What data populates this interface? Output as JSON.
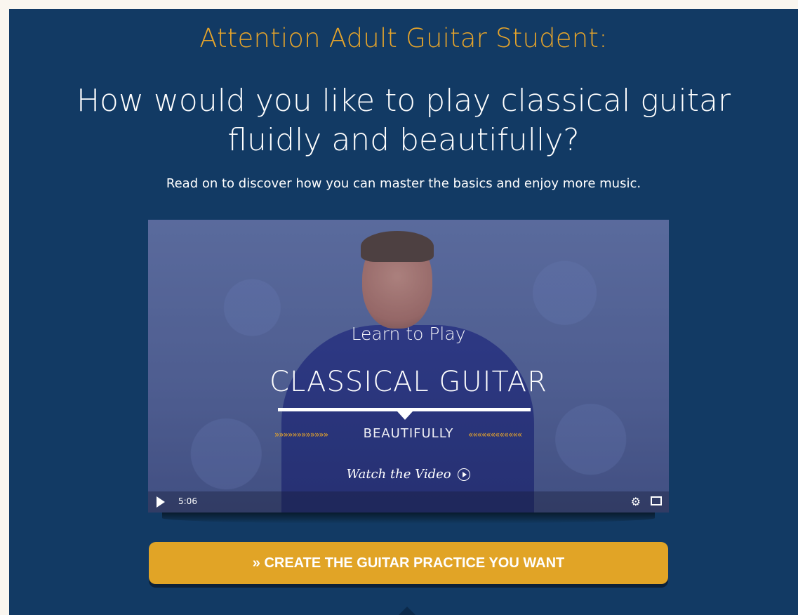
{
  "page": {
    "kicker": "Attention Adult Guitar Student:",
    "headline": "How would you like to play classical guitar fluidly and beautifully?",
    "subline": "Read on to discover how you can master the basics and enjoy more music.",
    "cta_label": "» CREATE THE GUITAR PRACTICE YOU WANT"
  },
  "video": {
    "learn": "Learn to Play",
    "classical": "CLASSICAL GUITAR",
    "beautifully": "BEAUTIFULLY",
    "chevrons_left": "»»»»»»»»»»»»",
    "chevrons_right": "««««««««««««",
    "watch": "Watch the Video",
    "time": "5:06"
  },
  "colors": {
    "background": "#faf6ef",
    "panel": "#123a64",
    "accent": "#e1a426",
    "kicker": "#e8a52a"
  },
  "icons": [
    "play-icon",
    "settings-gear-icon",
    "fullscreen-icon",
    "play-circle-icon"
  ]
}
